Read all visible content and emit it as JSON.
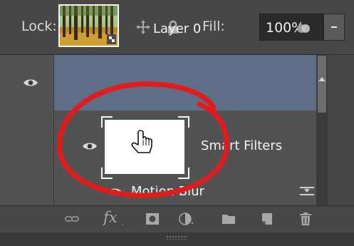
{
  "lock_row": {
    "lock_label": "Lock:",
    "fill_label": "Fill:",
    "fill_value": "100%",
    "icons": [
      "lock-transparent-pixels-icon",
      "lock-image-pixels-icon",
      "lock-position-icon",
      "lock-all-icon"
    ]
  },
  "layers": {
    "layer_name": "Layer 0",
    "smart_filters_label": "Smart Filters",
    "filter_name": "Motion Blur"
  },
  "toolbar": {
    "icons": [
      "link-layers-icon",
      "fx-icon",
      "add-mask-icon",
      "adjustment-layer-icon",
      "new-group-icon",
      "new-layer-icon",
      "trash-icon"
    ],
    "fx_label": "fx"
  },
  "colors": {
    "panel_bg": "#474747",
    "selected_row": "#5d6e86",
    "annotation_red": "#e41b1b"
  },
  "annotation": {
    "shape": "hand-drawn red ellipse around smart filter mask thumbnail",
    "cursor": "hand-pointer-icon"
  }
}
